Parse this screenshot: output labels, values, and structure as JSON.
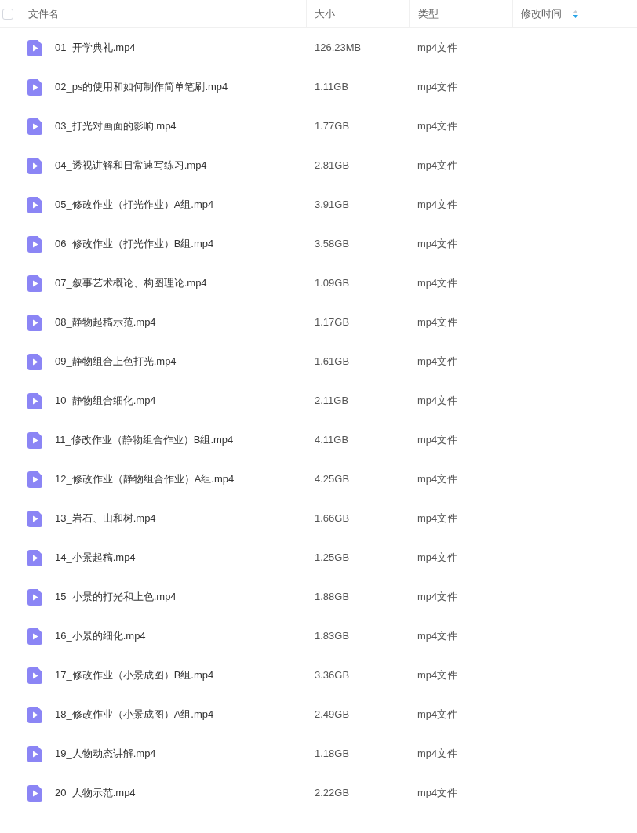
{
  "table": {
    "select_all": {
      "checked": false
    },
    "columns": [
      {
        "label": "文件名",
        "sorted": false
      },
      {
        "label": "大小",
        "sorted": false
      },
      {
        "label": "类型",
        "sorted": false
      },
      {
        "label": "修改时间",
        "sorted": true
      }
    ],
    "rows": [
      {
        "name": "01_开学典礼.mp4",
        "size": "126.23MB",
        "type": "mp4文件"
      },
      {
        "name": "02_ps的使用和如何制作简单笔刷.mp4",
        "size": "1.11GB",
        "type": "mp4文件"
      },
      {
        "name": "03_打光对画面的影响.mp4",
        "size": "1.77GB",
        "type": "mp4文件"
      },
      {
        "name": "04_透视讲解和日常速写练习.mp4",
        "size": "2.81GB",
        "type": "mp4文件"
      },
      {
        "name": "05_修改作业（打光作业）A组.mp4",
        "size": "3.91GB",
        "type": "mp4文件"
      },
      {
        "name": "06_修改作业（打光作业）B组.mp4",
        "size": "3.58GB",
        "type": "mp4文件"
      },
      {
        "name": "07_叙事艺术概论、构图理论.mp4",
        "size": "1.09GB",
        "type": "mp4文件"
      },
      {
        "name": "08_静物起稿示范.mp4",
        "size": "1.17GB",
        "type": "mp4文件"
      },
      {
        "name": "09_静物组合上色打光.mp4",
        "size": "1.61GB",
        "type": "mp4文件"
      },
      {
        "name": "10_静物组合细化.mp4",
        "size": "2.11GB",
        "type": "mp4文件"
      },
      {
        "name": "11_修改作业（静物组合作业）B组.mp4",
        "size": "4.11GB",
        "type": "mp4文件"
      },
      {
        "name": "12_修改作业（静物组合作业）A组.mp4",
        "size": "4.25GB",
        "type": "mp4文件"
      },
      {
        "name": "13_岩石、山和树.mp4",
        "size": "1.66GB",
        "type": "mp4文件"
      },
      {
        "name": "14_小景起稿.mp4",
        "size": "1.25GB",
        "type": "mp4文件"
      },
      {
        "name": "15_小景的打光和上色.mp4",
        "size": "1.88GB",
        "type": "mp4文件"
      },
      {
        "name": "16_小景的细化.mp4",
        "size": "1.83GB",
        "type": "mp4文件"
      },
      {
        "name": "17_修改作业（小景成图）B组.mp4",
        "size": "3.36GB",
        "type": "mp4文件"
      },
      {
        "name": "18_修改作业（小景成图）A组.mp4",
        "size": "2.49GB",
        "type": "mp4文件"
      },
      {
        "name": "19_人物动态讲解.mp4",
        "size": "1.18GB",
        "type": "mp4文件"
      },
      {
        "name": "20_人物示范.mp4",
        "size": "2.22GB",
        "type": "mp4文件"
      }
    ]
  }
}
